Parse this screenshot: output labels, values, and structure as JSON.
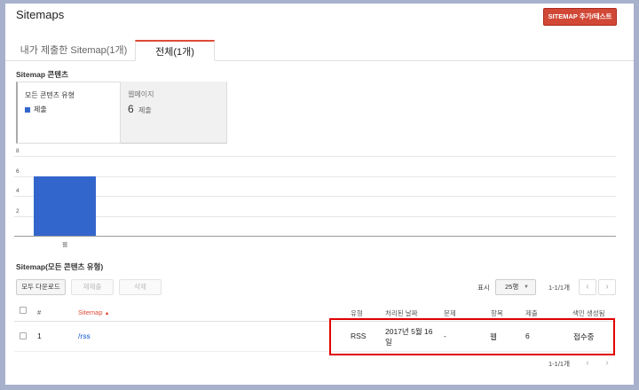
{
  "header": {
    "title": "Sitemaps",
    "add_button": "SITEMAP 추가/테스트"
  },
  "tabs": [
    {
      "label": "내가 제출한 Sitemap(1개)",
      "active": false
    },
    {
      "label": "전체(1개)",
      "active": true
    }
  ],
  "content_section": {
    "title": "Sitemap 콘텐츠",
    "cards": [
      {
        "title": "모든 콘텐츠 유형",
        "legend": "제출",
        "legend_color": "#3366cc"
      },
      {
        "title": "웹페이지",
        "count": "6",
        "unit": "제출"
      }
    ]
  },
  "chart_data": {
    "type": "bar",
    "categories": [
      "웹"
    ],
    "series": [
      {
        "values": [
          6
        ]
      }
    ],
    "ylim": [
      0,
      8
    ],
    "yticks": [
      "2",
      "4",
      "6",
      "8"
    ],
    "grid": true,
    "color": "#3366cc"
  },
  "list_section": {
    "title": "Sitemap(모든 콘텐츠 유형)",
    "buttons": {
      "download": "모두 다운로드",
      "resubmit": "재제출",
      "delete": "삭제"
    },
    "show_label": "표시",
    "page_size": "25행",
    "pager": "1-1/1개",
    "columns": [
      "#",
      "Sitemap",
      "유형",
      "처리된 날짜",
      "문제",
      "항목",
      "제출",
      "색인 생성됨"
    ],
    "rows": [
      {
        "num": "1",
        "sitemap": "/rss",
        "type": "RSS",
        "date_line1": "2017년 5월 16",
        "date_line2": "일",
        "issues": "-",
        "items": "웹",
        "submitted": "6",
        "indexed": "접수중"
      }
    ]
  },
  "colors": {
    "accent_red": "#dd4b39",
    "bar_blue": "#3366cc",
    "highlight": "#e00000",
    "link": "#1155cc"
  }
}
